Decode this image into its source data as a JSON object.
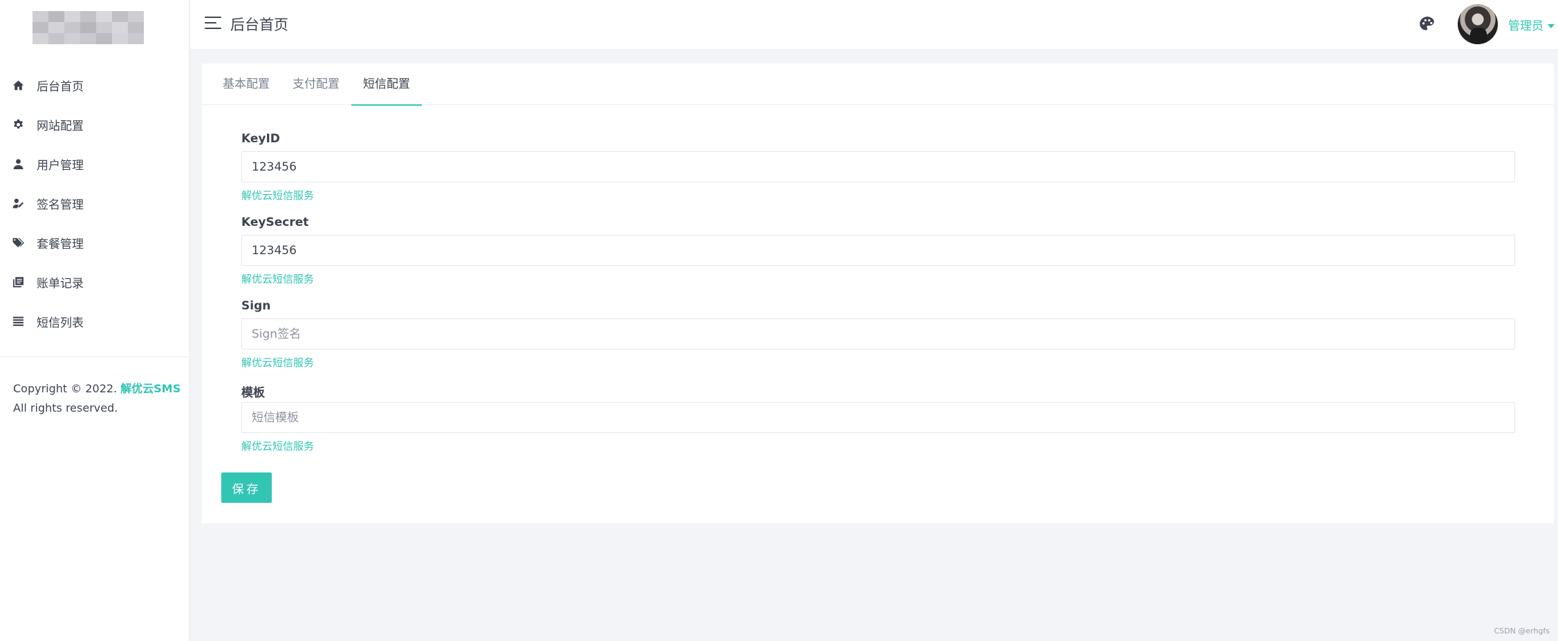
{
  "sidebar": {
    "items": [
      {
        "label": "后台首页",
        "icon": "home-icon"
      },
      {
        "label": "网站配置",
        "icon": "gear-icon"
      },
      {
        "label": "用户管理",
        "icon": "user-icon"
      },
      {
        "label": "签名管理",
        "icon": "signature-icon"
      },
      {
        "label": "套餐管理",
        "icon": "tags-icon"
      },
      {
        "label": "账单记录",
        "icon": "bill-icon"
      },
      {
        "label": "短信列表",
        "icon": "list-icon"
      }
    ],
    "copyright_prefix": "Copyright © 2022.",
    "copyright_link": "解优云SMS",
    "copyright_suffix": "All rights reserved."
  },
  "header": {
    "title": "后台首页",
    "user_name": "管理员"
  },
  "tabs": [
    {
      "label": "基本配置"
    },
    {
      "label": "支付配置"
    },
    {
      "label": "短信配置",
      "active": true
    }
  ],
  "form": {
    "fields": [
      {
        "label": "KeyID",
        "value": "123456",
        "placeholder": "",
        "help": "解优云短信服务"
      },
      {
        "label": "KeySecret",
        "value": "123456",
        "placeholder": "",
        "help": "解优云短信服务"
      },
      {
        "label": "Sign",
        "value": "",
        "placeholder": "Sign签名",
        "help": "解优云短信服务"
      },
      {
        "label": "模板",
        "value": "",
        "placeholder": "短信模板",
        "help": "解优云短信服务"
      }
    ],
    "save_label": "保存"
  },
  "watermark": "CSDN @erhgfs",
  "colors": {
    "accent": "#2fc5b3",
    "background": "#f3f4f8",
    "text": "#3d4350"
  }
}
